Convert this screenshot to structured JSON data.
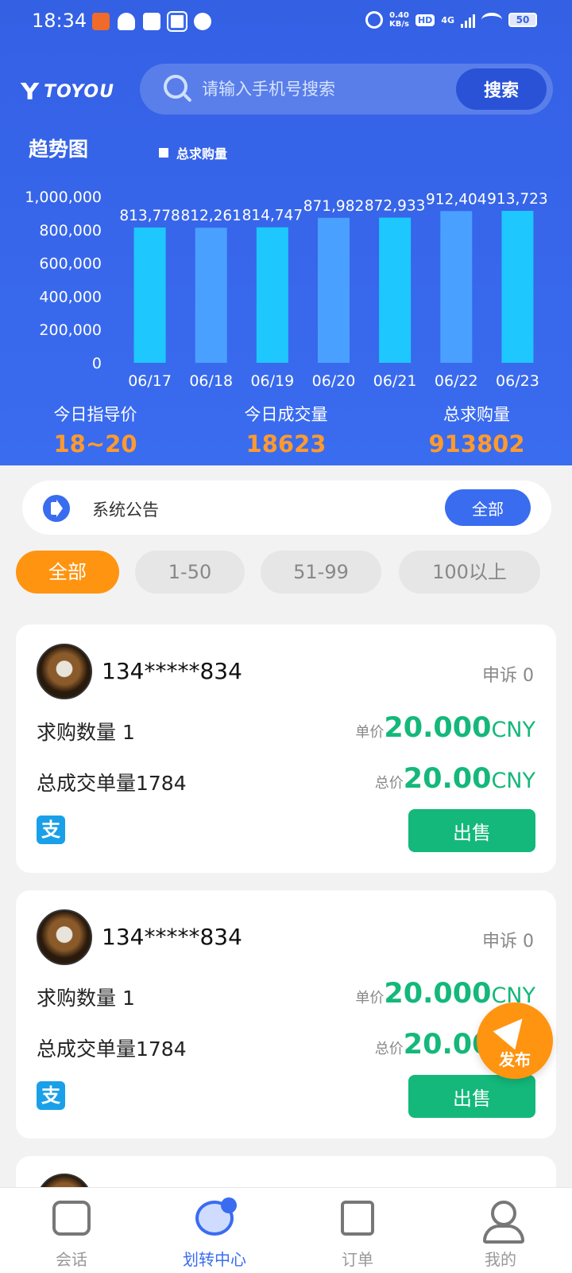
{
  "status_bar": {
    "time": "18:34",
    "net_speed": "0.40",
    "net_speed_unit": "KB/s",
    "hd": "HD",
    "network": "4G",
    "battery": "50"
  },
  "header": {
    "logo_text": "TOYOU",
    "search_placeholder": "请输入手机号搜索",
    "search_button": "搜索"
  },
  "chart_data": {
    "type": "bar",
    "title": "趋势图",
    "legend": [
      "总求购量"
    ],
    "categories": [
      "06/17",
      "06/18",
      "06/19",
      "06/20",
      "06/21",
      "06/22",
      "06/23"
    ],
    "series": [
      {
        "name": "总求购量",
        "values": [
          813778,
          812261,
          814747,
          871982,
          872933,
          912404,
          913723
        ]
      }
    ],
    "data_labels": [
      "813,778",
      "812,261",
      "814,747",
      "871,982",
      "872,933",
      "912,404",
      "913,723"
    ],
    "y_ticks": [
      "0",
      "200,000",
      "400,000",
      "600,000",
      "800,000",
      "1,000,000"
    ],
    "ylim": [
      0,
      1000000
    ],
    "grid": false,
    "colors": [
      "#1ec8ff",
      "#4aa0ff"
    ]
  },
  "stats": [
    {
      "label": "今日指导价",
      "value": "18~20"
    },
    {
      "label": "今日成交量",
      "value": "18623"
    },
    {
      "label": "总求购量",
      "value": "913802"
    }
  ],
  "notice": {
    "text": "系统公告",
    "button": "全部"
  },
  "filters": [
    "全部",
    "1-50",
    "51-99",
    "100以上"
  ],
  "orders": [
    {
      "user": "134*****834",
      "appeal": "申诉 0",
      "quantity": "求购数量 1",
      "total_deals": "总成交单量1784",
      "unit_price_label": "单价",
      "unit_price": "20.000",
      "total_price_label": "总价",
      "total_price": "20.00",
      "currency": "CNY",
      "pay_icon": "支",
      "action": "出售"
    },
    {
      "user": "134*****834",
      "appeal": "申诉 0",
      "quantity": "求购数量 1",
      "total_deals": "总成交单量1784",
      "unit_price_label": "单价",
      "unit_price": "20.000",
      "total_price_label": "总价",
      "total_price": "20.00",
      "currency": "CNY",
      "pay_icon": "支",
      "action": "出售"
    }
  ],
  "fab": {
    "label": "发布"
  },
  "bottom_nav": [
    {
      "label": "会话",
      "icon": "chat-icon"
    },
    {
      "label": "划转中心",
      "icon": "transfer-icon"
    },
    {
      "label": "订单",
      "icon": "order-icon"
    },
    {
      "label": "我的",
      "icon": "user-icon"
    }
  ],
  "colors": {
    "primary": "#3a6cf0",
    "accent": "#ff9410",
    "success": "#13b87a"
  }
}
